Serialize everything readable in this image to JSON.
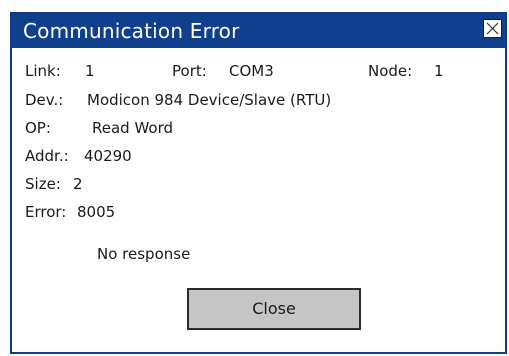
{
  "dialog": {
    "title": "Communication Error",
    "close_icon": "close-icon"
  },
  "info": {
    "link_label": "Link:",
    "link_value": "1",
    "port_label": "Port:",
    "port_value": "COM3",
    "node_label": "Node:",
    "node_value": "1",
    "dev_label": "Dev.:",
    "dev_value": "Modicon 984 Device/Slave (RTU)",
    "op_label": "OP:",
    "op_value": "Read Word",
    "addr_label": "Addr.:",
    "addr_value": "40290",
    "size_label": "Size:",
    "size_value": "2",
    "error_label": "Error:",
    "error_value": "8005",
    "message": "No response"
  },
  "buttons": {
    "close_label": "Close"
  },
  "colors": {
    "titlebar": "#103f8e",
    "button": "#c5c5c5"
  }
}
